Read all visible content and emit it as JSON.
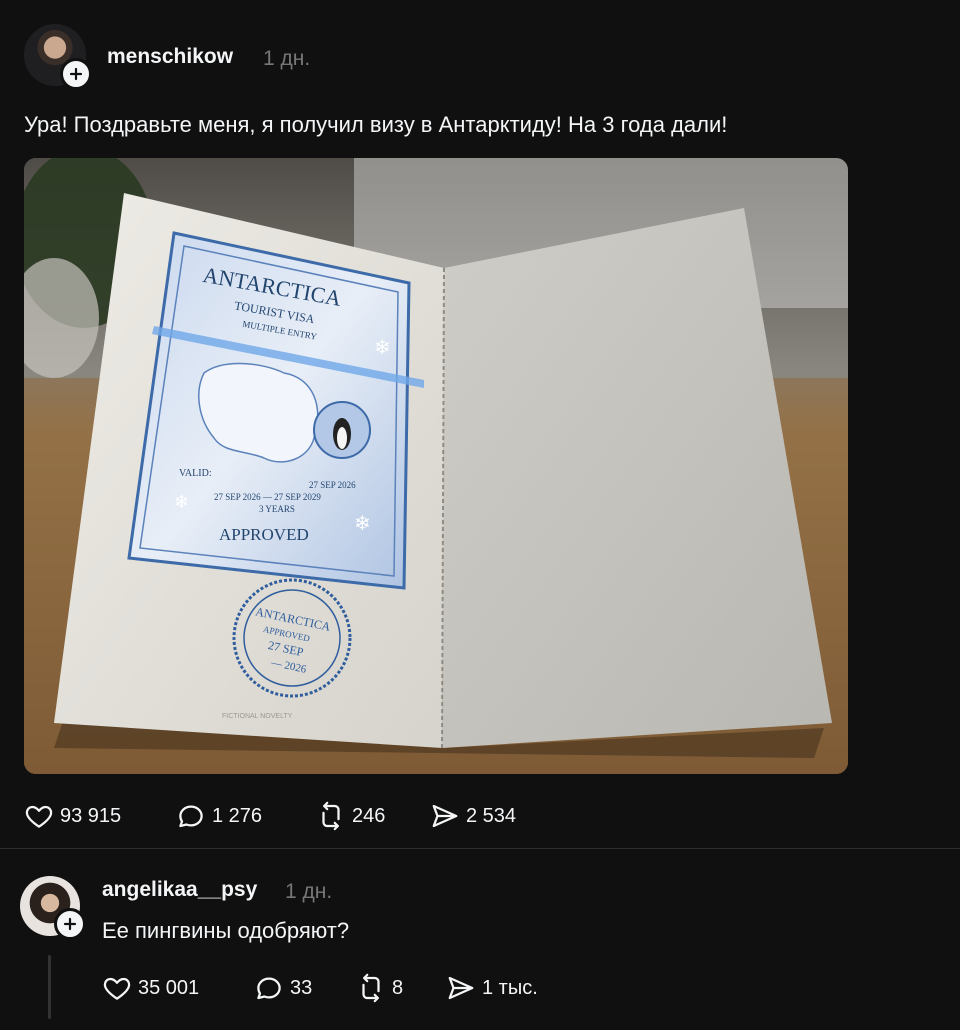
{
  "post": {
    "username": "menschikow",
    "time": "1 дн.",
    "text": "Ура! Поздравьте меня, я получил визу в Антарктиду! На 3 года дали!",
    "image": {
      "visa_title": "ANTARCTICA",
      "visa_sub1": "TOURIST VISA",
      "visa_sub2": "MULTIPLE ENTRY",
      "valid_label": "VALID:",
      "valid_dates": "27 SEP 2026 — 27 SEP 2029",
      "valid_small": "27 SEP 2026",
      "valid_years": "3 YEARS",
      "approved": "APPROVED",
      "stamp_top": "ANTARCTICA",
      "stamp_mid": "APPROVED",
      "stamp_date": "27 SEP",
      "stamp_year": "— 2026",
      "footer_note": "FICTIONAL NOVELTY"
    },
    "likes": "93 915",
    "comments": "1 276",
    "reposts": "246",
    "shares": "2 534"
  },
  "reply": {
    "username": "angelikaa__psy",
    "time": "1 дн.",
    "text": "Ее пингвины одобряют?",
    "likes": "35 001",
    "comments": "33",
    "reposts": "8",
    "shares": "1 тыс."
  },
  "icons": {
    "like": "heart-icon",
    "comment": "speech-bubble-icon",
    "repost": "repost-icon",
    "share": "send-icon",
    "follow": "plus-icon"
  },
  "colors": {
    "background": "#101010",
    "text": "#f3f5f7",
    "muted": "#777777",
    "visa_blue": "#2f5d9e"
  }
}
